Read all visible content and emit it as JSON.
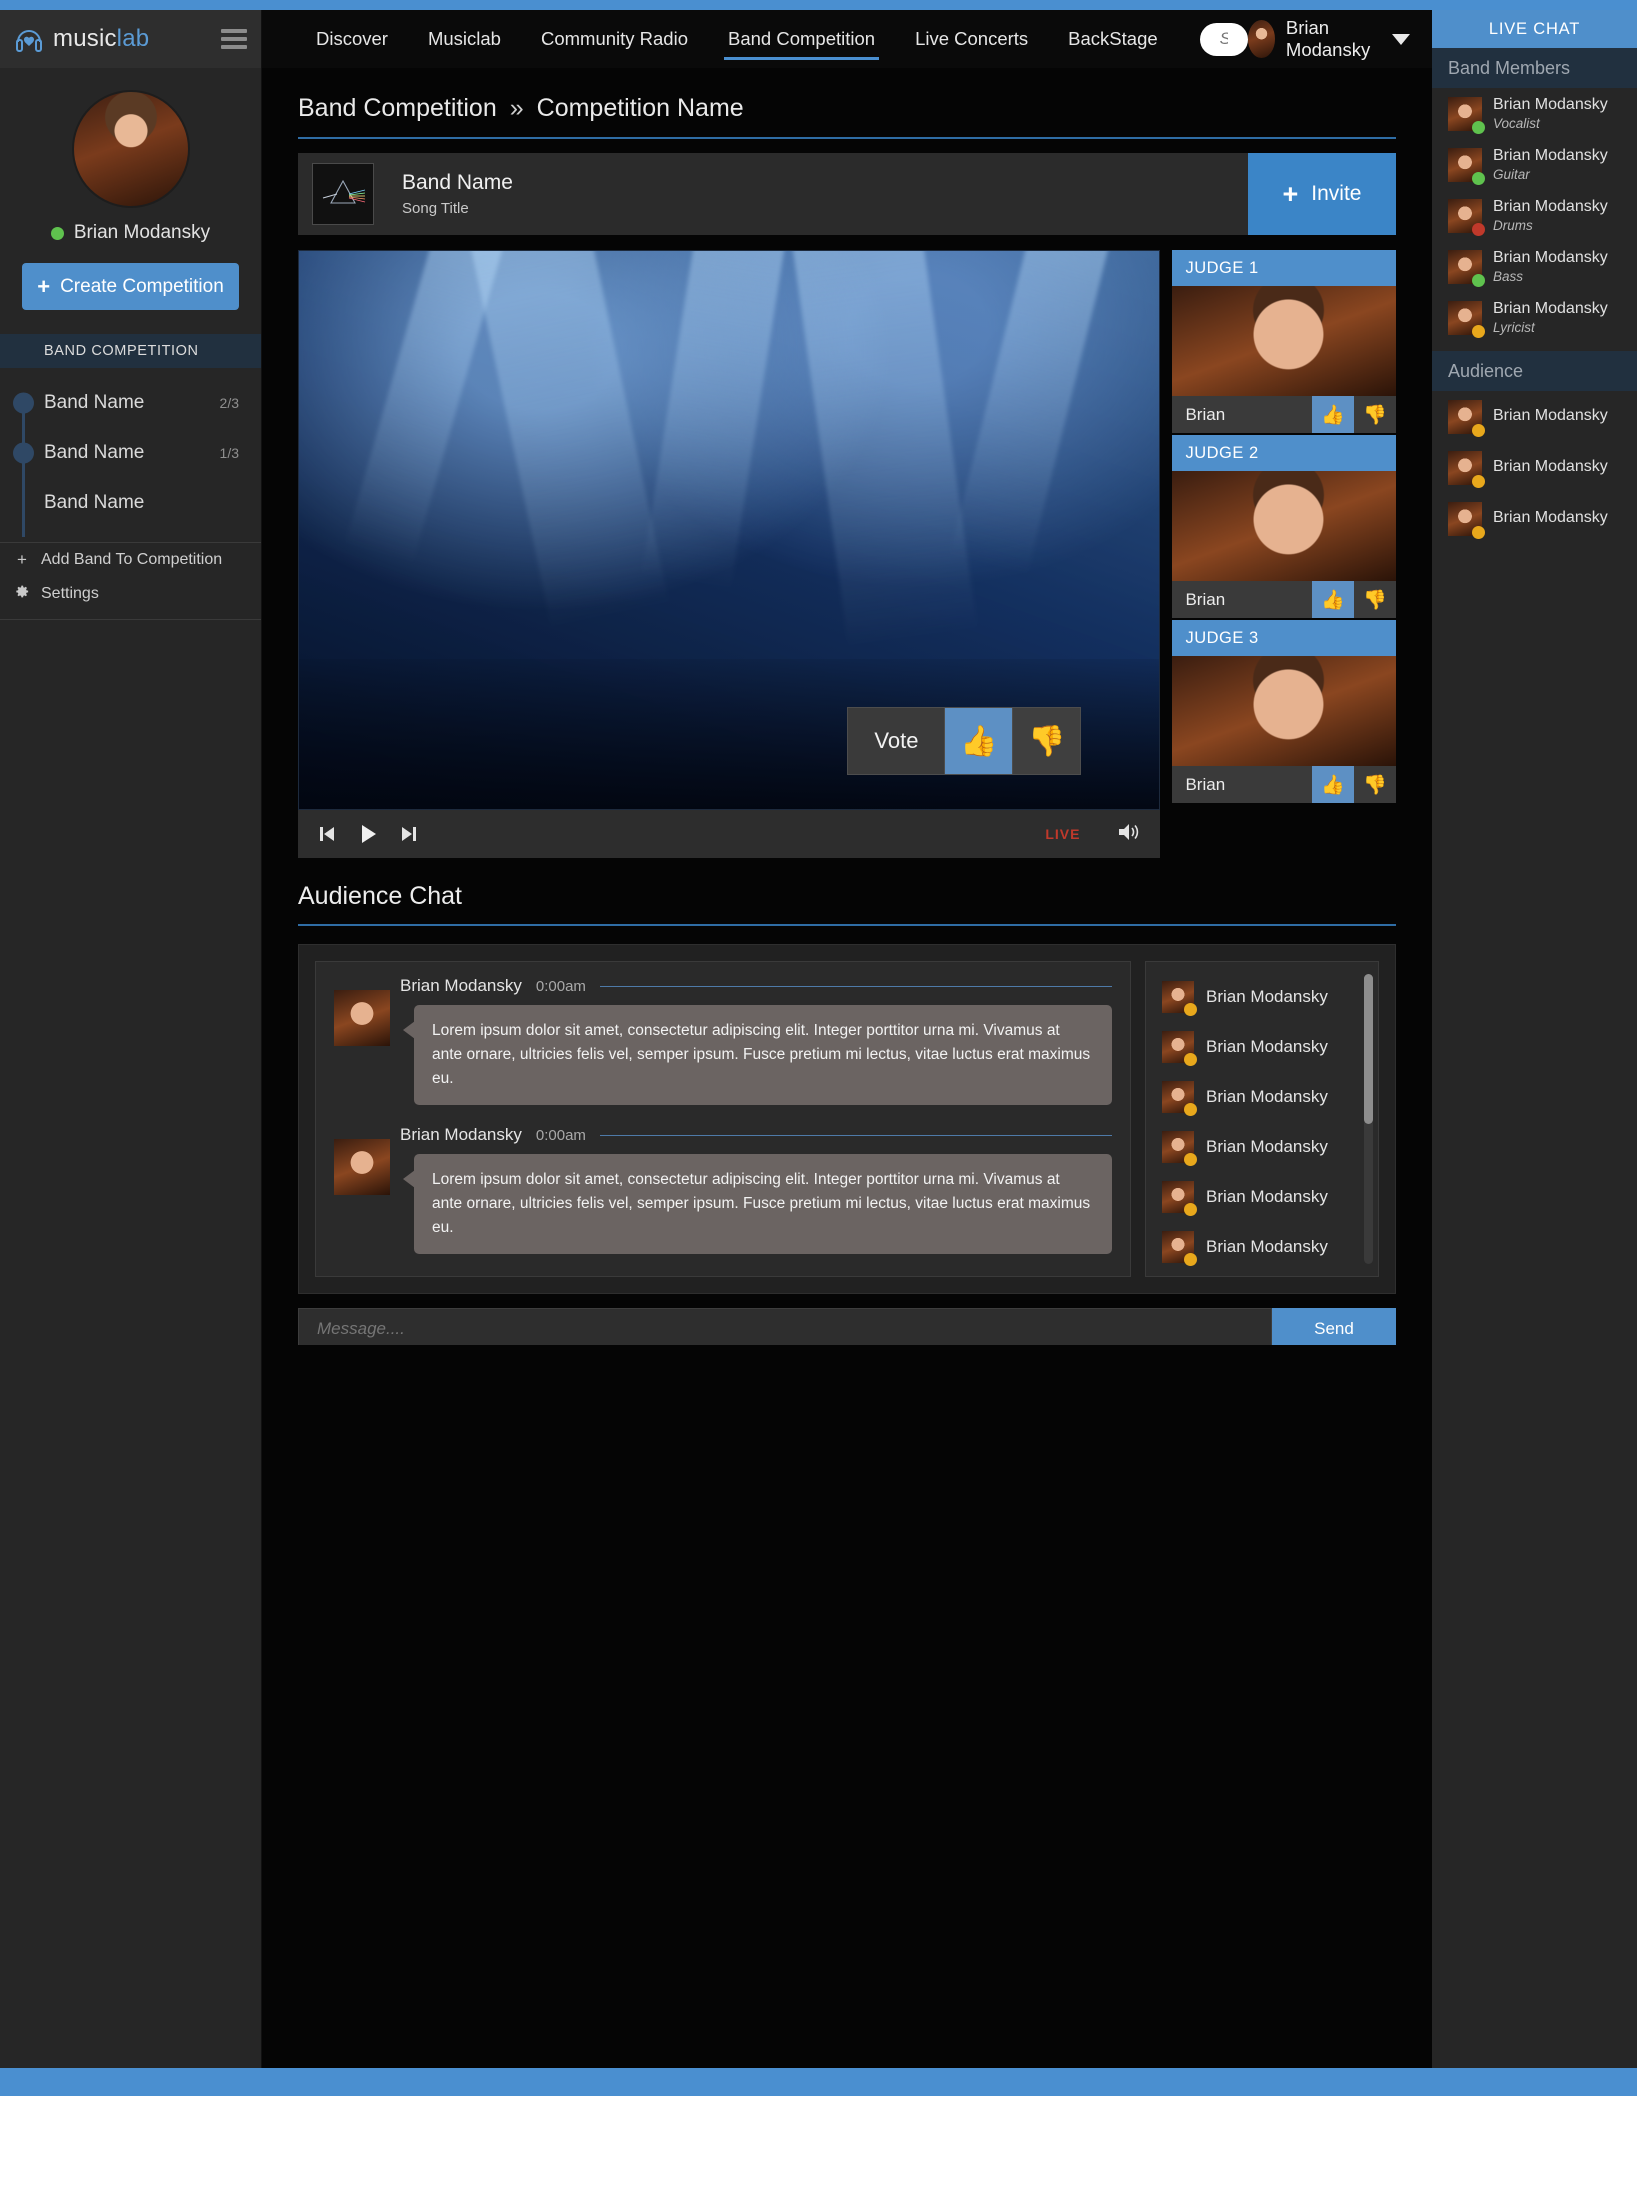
{
  "brand": {
    "name_1": "music",
    "name_2": "lab",
    "logo_icon": "headphones-icon",
    "menu_icon": "hamburger-icon"
  },
  "topnav": {
    "items": [
      {
        "label": "Discover",
        "active": false
      },
      {
        "label": "Musiclab",
        "active": false
      },
      {
        "label": "Community Radio",
        "active": false
      },
      {
        "label": "Band Competition",
        "active": true
      },
      {
        "label": "Live Concerts",
        "active": false
      },
      {
        "label": "BackStage",
        "active": false
      }
    ],
    "search": {
      "placeholder": "Search",
      "value": "",
      "icon": "search-icon"
    },
    "user": {
      "name": "Brian Modansky",
      "caret_icon": "chevron-down-icon",
      "avatar": "user-avatar"
    }
  },
  "sidebar": {
    "profile": {
      "name": "Brian Modansky",
      "status": "online",
      "status_color": "#5fc24e",
      "avatar": "profile-avatar"
    },
    "create_button": {
      "label": "Create Competition",
      "icon": "plus-icon"
    },
    "section_title": "BAND COMPETITION",
    "bands": [
      {
        "label": "Band Name",
        "count": "2/3"
      },
      {
        "label": "Band Name",
        "count": "1/3"
      },
      {
        "label": "Band Name",
        "count": ""
      }
    ],
    "actions": [
      {
        "label": "Add Band To Competition",
        "icon": "plus-icon"
      },
      {
        "label": "Settings",
        "icon": "gear-icon"
      }
    ]
  },
  "breadcrumb": {
    "root": "Band Competition",
    "separator": "»",
    "current": "Competition Name"
  },
  "bandbar": {
    "band_name": "Band Name",
    "song_title": "Song Title",
    "album_art": "album-art-prism",
    "invite_label": "Invite",
    "invite_icon": "plus-icon"
  },
  "player": {
    "vote_label": "Vote",
    "thumb_up_icon": "thumbs-up-icon",
    "thumb_down_icon": "thumbs-down-icon",
    "prev_icon": "skip-previous-icon",
    "play_icon": "play-icon",
    "next_icon": "skip-next-icon",
    "live_label": "LIVE",
    "volume_icon": "volume-icon",
    "live_color": "#c0392b"
  },
  "judges": [
    {
      "title": "JUDGE 1",
      "name": "Brian",
      "up_icon": "thumbs-up-icon",
      "down_icon": "thumbs-down-icon"
    },
    {
      "title": "JUDGE 2",
      "name": "Brian",
      "up_icon": "thumbs-up-icon",
      "down_icon": "thumbs-down-icon"
    },
    {
      "title": "JUDGE 3",
      "name": "Brian",
      "up_icon": "thumbs-up-icon",
      "down_icon": "thumbs-down-icon"
    }
  ],
  "chat": {
    "title": "Audience Chat",
    "messages": [
      {
        "name": "Brian Modansky",
        "time": "0:00am",
        "text": "Lorem ipsum dolor sit amet, consectetur adipiscing elit. Integer porttitor urna mi. Vivamus at ante ornare, ultricies felis vel, semper ipsum. Fusce pretium mi lectus, vitae luctus erat maximus eu."
      },
      {
        "name": "Brian Modansky",
        "time": "0:00am",
        "text": "Lorem ipsum dolor sit amet, consectetur adipiscing elit. Integer porttitor urna mi. Vivamus at ante ornare, ultricies felis vel, semper ipsum. Fusce pretium mi lectus, vitae luctus erat maximus eu."
      }
    ],
    "users": [
      {
        "name": "Brian Modansky",
        "status_color": "#e8a81c"
      },
      {
        "name": "Brian Modansky",
        "status_color": "#e8a81c"
      },
      {
        "name": "Brian Modansky",
        "status_color": "#e8a81c"
      },
      {
        "name": "Brian Modansky",
        "status_color": "#e8a81c"
      },
      {
        "name": "Brian Modansky",
        "status_color": "#e8a81c"
      },
      {
        "name": "Brian Modansky",
        "status_color": "#e8a81c"
      }
    ],
    "input": {
      "placeholder": "Message....",
      "value": ""
    },
    "send_label": "Send"
  },
  "rail": {
    "header": "LIVE CHAT",
    "band_members_title": "Band Members",
    "band_members": [
      {
        "name": "Brian Modansky",
        "role": "Vocalist",
        "status_color": "#5fc24e"
      },
      {
        "name": "Brian Modansky",
        "role": "Guitar",
        "status_color": "#5fc24e"
      },
      {
        "name": "Brian Modansky",
        "role": "Drums",
        "status_color": "#c0392b"
      },
      {
        "name": "Brian Modansky",
        "role": "Bass",
        "status_color": "#5fc24e"
      },
      {
        "name": "Brian Modansky",
        "role": "Lyricist",
        "status_color": "#e8a81c"
      }
    ],
    "audience_title": "Audience",
    "audience": [
      {
        "name": "Brian Modansky",
        "status_color": "#e8a81c"
      },
      {
        "name": "Brian Modansky",
        "status_color": "#e8a81c"
      },
      {
        "name": "Brian Modansky",
        "status_color": "#e8a81c"
      }
    ]
  },
  "theme": {
    "accent": "#4a8fd0",
    "panel": "#262626",
    "background": "#050505"
  }
}
